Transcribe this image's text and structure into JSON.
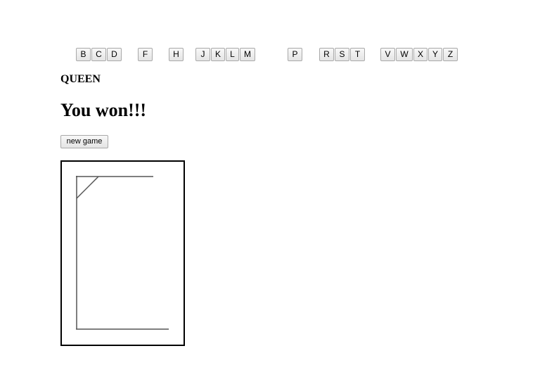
{
  "letters": [
    "B",
    "C",
    "D",
    "F",
    "H",
    "J",
    "K",
    "L",
    "M",
    "P",
    "R",
    "S",
    "T",
    "V",
    "W",
    "X",
    "Y",
    "Z"
  ],
  "word": "QUEEN",
  "status": "You won!!!",
  "new_game_label": "new game",
  "colors": {
    "button_border": "#a9a9a9",
    "button_bg": "#efefef",
    "gallows_line": "#555555",
    "frame_border": "#000000"
  }
}
